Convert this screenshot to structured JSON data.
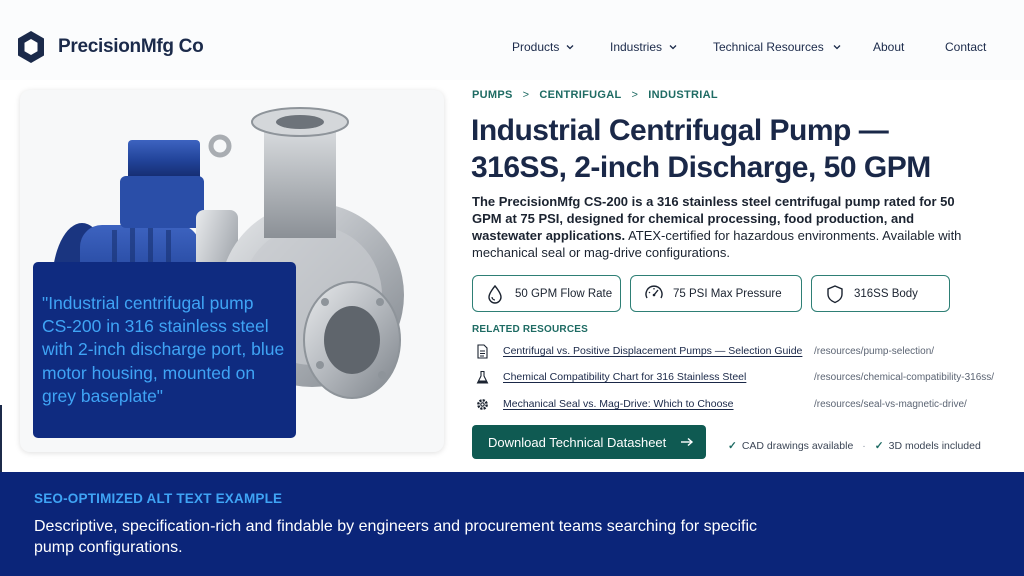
{
  "brand": {
    "name": "PrecisionMfg Co",
    "color": "#1b2a4a"
  },
  "nav": [
    {
      "label": "Products",
      "has_dropdown": true
    },
    {
      "label": "Industries",
      "has_dropdown": true
    },
    {
      "label": "Technical Resources",
      "has_dropdown": true
    },
    {
      "label": "About",
      "has_dropdown": false
    },
    {
      "label": "Contact",
      "has_dropdown": false
    }
  ],
  "breadcrumb": [
    "PUMPS",
    "CENTRIFUGAL",
    "INDUSTRIAL"
  ],
  "breadcrumb_separator": ">",
  "product": {
    "title_line1": "Industrial Centrifugal Pump —",
    "title_line2": "316SS, 2-inch Discharge, 50 GPM",
    "description_bold": "The PrecisionMfg CS-200 is a 316 stainless steel centrifugal pump rated for 50 GPM at 75 PSI, designed for chemical processing, food production, and wastewater applications.",
    "description_rest": " ATEX-certified for hazardous environments. Available with mechanical seal or mag-drive configurations.",
    "image_icon": "centrifugal-pump-photo"
  },
  "alt_text_overlay": "\"Industrial centrifugal pump CS-200 in 316 stainless steel with 2-inch discharge port, blue motor housing, mounted on grey baseplate\"",
  "specs": [
    {
      "label": "50 GPM Flow Rate",
      "icon": "droplet-icon"
    },
    {
      "label": "75 PSI Max Pressure",
      "icon": "gauge-icon"
    },
    {
      "label": "316SS Body",
      "icon": "shield-icon"
    }
  ],
  "related_resources_title": "RELATED RESOURCES",
  "resources": [
    {
      "title": "Centrifugal vs. Positive Displacement Pumps — Selection Guide",
      "path": "/resources/pump-selection/",
      "icon": "document-icon"
    },
    {
      "title": "Chemical Compatibility Chart for 316 Stainless Steel",
      "path": "/resources/chemical-compatibility-316ss/",
      "icon": "flask-icon"
    },
    {
      "title": "Mechanical Seal vs. Mag-Drive: Which to Choose",
      "path": "/resources/seal-vs-magnetic-drive/",
      "icon": "gear-icon"
    }
  ],
  "cta": {
    "label": "Download Technical Datasheet",
    "icon": "arrow-right-icon"
  },
  "availability": [
    "CAD drawings available",
    "3D models included"
  ],
  "availability_separator": "·",
  "banner": {
    "title": "SEO-OPTIMIZED ALT TEXT EXAMPLE",
    "text": "Descriptive, specification-rich and findable by engineers and procurement teams searching for specific pump configurations."
  },
  "colors": {
    "accent_teal": "#1e6b63",
    "button_teal": "#0f5a52",
    "navy": "#1a2848",
    "banner_blue": "#0b2579",
    "overlay_blue": "#0f2b80",
    "overlay_text": "#3fa4f5",
    "motor_blue": "#22449a"
  }
}
